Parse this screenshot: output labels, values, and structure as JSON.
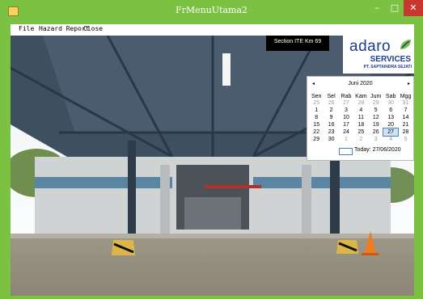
{
  "window": {
    "title": "FrMenuUtama2",
    "minimize_glyph": "–",
    "maximize_glyph": "□",
    "close_glyph": "✕"
  },
  "menu": {
    "items": [
      "File",
      "Hazard Report",
      "Close"
    ]
  },
  "overlay": {
    "section_label": "Section ITE Km 69"
  },
  "logo": {
    "brand": "adaro",
    "services": "SERVICES",
    "company": "PT. SAPTAINDRA SEJATI"
  },
  "calendar": {
    "month_label": "Juni 2020",
    "prev_glyph": "◂",
    "next_glyph": "▸",
    "weekdays": [
      "Sen",
      "Sel",
      "Rab",
      "Kam",
      "Jum",
      "Sab",
      "Mgg"
    ],
    "weeks": [
      [
        "25",
        "26",
        "27",
        "28",
        "29",
        "30",
        "31"
      ],
      [
        "1",
        "2",
        "3",
        "4",
        "5",
        "6",
        "7"
      ],
      [
        "8",
        "9",
        "10",
        "11",
        "12",
        "13",
        "14"
      ],
      [
        "15",
        "16",
        "17",
        "18",
        "19",
        "20",
        "21"
      ],
      [
        "22",
        "23",
        "24",
        "25",
        "26",
        "27",
        "28"
      ],
      [
        "29",
        "30",
        "1",
        "2",
        "3",
        "4",
        "5"
      ]
    ],
    "selected_day": "27",
    "today_label": "Today: 27/06/2020"
  },
  "colors": {
    "titlebar": "#7bc142",
    "close_button": "#c7372f",
    "brand_blue": "#1d3c8f",
    "logo_green": "#7bc142"
  }
}
